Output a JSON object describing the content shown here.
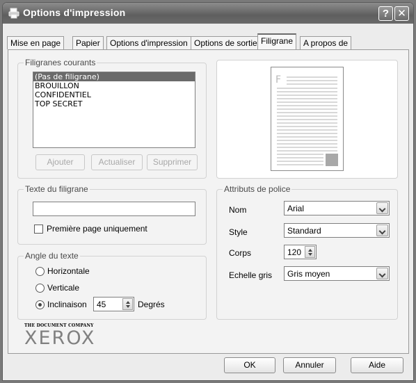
{
  "window": {
    "title": "Options d'impression",
    "help_label": "?",
    "close_label": "✕"
  },
  "tabs": [
    {
      "label": "Mise en page"
    },
    {
      "label": "Papier"
    },
    {
      "label": "Options d'impression"
    },
    {
      "label": "Options de sortie"
    },
    {
      "label": "Filigrane",
      "active": true
    },
    {
      "label": "A propos de"
    }
  ],
  "watermarks": {
    "legend": "Filigranes courants",
    "items": [
      "(Pas de filigrane)",
      "BROUILLON",
      "CONFIDENTIEL",
      "TOP SECRET"
    ],
    "selected": "(Pas de filigrane)",
    "add_label": "Ajouter",
    "update_label": "Actualiser",
    "delete_label": "Supprimer"
  },
  "preview": {
    "page_letter": "F"
  },
  "watermark_text": {
    "legend": "Texte du filigrane",
    "value": "",
    "first_page_only_label": "Première page uniquement",
    "first_page_only_checked": false
  },
  "text_angle": {
    "legend": "Angle du texte",
    "horizontal_label": "Horizontale",
    "vertical_label": "Verticale",
    "inclination_label": "Inclinaison",
    "inclination_value": "45",
    "degrees_label": "Degrés",
    "selected": "Inclinaison"
  },
  "font_attributes": {
    "legend": "Attributs de police",
    "name_label": "Nom",
    "name_value": "Arial",
    "style_label": "Style",
    "style_value": "Standard",
    "size_label": "Corps",
    "size_value": "120",
    "gray_label": "Echelle gris",
    "gray_value": "Gris moyen"
  },
  "branding": {
    "company_tagline": "THE DOCUMENT COMPANY",
    "logo": "XEROX"
  },
  "buttons": {
    "ok_label": "OK",
    "cancel_label": "Annuler",
    "help_label": "Aide"
  }
}
